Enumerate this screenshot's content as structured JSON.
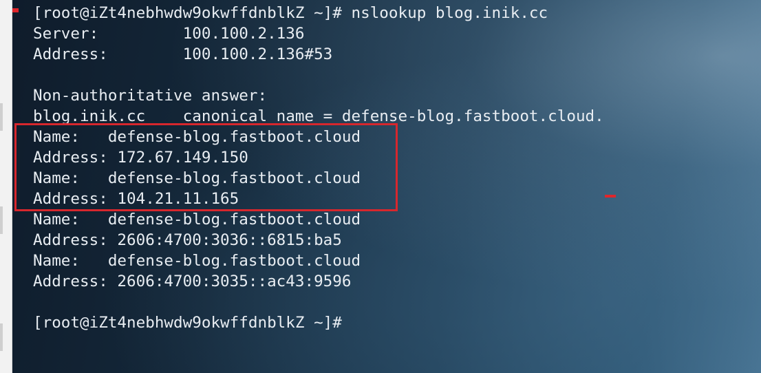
{
  "terminal": {
    "lines": [
      "[root@iZt4nebhwdw9okwffdnblkZ ~]# nslookup blog.inik.cc",
      "Server:         100.100.2.136",
      "Address:        100.100.2.136#53",
      "",
      "Non-authoritative answer:",
      "blog.inik.cc    canonical name = defense-blog.fastboot.cloud.",
      "Name:   defense-blog.fastboot.cloud",
      "Address: 172.67.149.150",
      "Name:   defense-blog.fastboot.cloud",
      "Address: 104.21.11.165",
      "Name:   defense-blog.fastboot.cloud",
      "Address: 2606:4700:3036::6815:ba5",
      "Name:   defense-blog.fastboot.cloud",
      "Address: 2606:4700:3035::ac43:9596",
      "",
      "[root@iZt4nebhwdw9okwffdnblkZ ~]#"
    ]
  },
  "colors": {
    "terminal_text": "#e8edf2",
    "highlight_border": "#d7272d",
    "background_dark": "#0f1c2b",
    "background_light": "#4a7898"
  }
}
